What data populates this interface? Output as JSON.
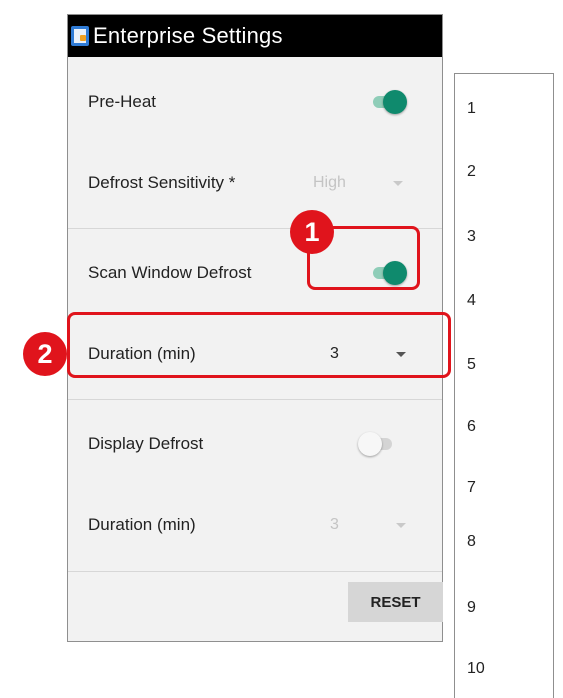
{
  "app": {
    "title": "Enterprise Settings"
  },
  "settings": {
    "preheat": {
      "label": "Pre-Heat",
      "enabled": true
    },
    "defrost_sensitivity": {
      "label": "Defrost Sensitivity *",
      "value": "High"
    },
    "scan_window_defrost": {
      "label": "Scan Window Defrost",
      "enabled": true
    },
    "scan_duration": {
      "label": "Duration (min)",
      "value": "3"
    },
    "display_defrost": {
      "label": "Display Defrost",
      "enabled": false
    },
    "display_duration": {
      "label": "Duration (min)",
      "value": "3"
    }
  },
  "buttons": {
    "reset": "RESET"
  },
  "callouts": {
    "one": "1",
    "two": "2"
  },
  "dropdown": {
    "options": [
      "1",
      "2",
      "3",
      "4",
      "5",
      "6",
      "7",
      "8",
      "9",
      "10"
    ]
  },
  "colors": {
    "accent": "#0f8a6d",
    "highlight": "#e0141c",
    "titlebar": "#000000"
  }
}
